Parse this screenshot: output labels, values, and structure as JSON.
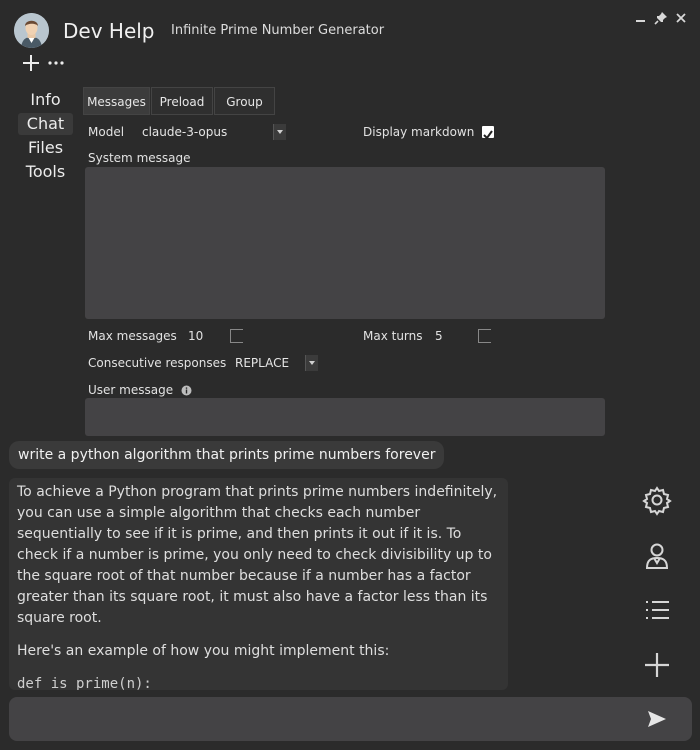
{
  "header": {
    "app_title": "Dev Help",
    "chat_title": "Infinite Prime Number Generator",
    "minimize_icon": "minimize-icon",
    "pin_icon": "pin-icon",
    "close_icon": "close-icon"
  },
  "toolbar": {
    "add_label": "+",
    "more_label": "···"
  },
  "nav": {
    "items": [
      {
        "label": "Info",
        "active": false
      },
      {
        "label": "Chat",
        "active": true
      },
      {
        "label": "Files",
        "active": false
      },
      {
        "label": "Tools",
        "active": false
      }
    ]
  },
  "tabs": [
    {
      "label": "Messages",
      "active": true
    },
    {
      "label": "Preload",
      "active": false
    },
    {
      "label": "Group",
      "active": false
    }
  ],
  "settings": {
    "model_label": "Model",
    "model_value": "claude-3-opus",
    "display_markdown_label": "Display markdown",
    "display_markdown_checked": true,
    "system_message_label": "System message",
    "system_message_value": "",
    "max_messages_label": "Max messages",
    "max_messages_value": "10",
    "max_turns_label": "Max turns",
    "max_turns_value": "5",
    "consecutive_label": "Consecutive responses",
    "consecutive_value": "REPLACE",
    "user_message_label": "User message",
    "user_message_value": ""
  },
  "chat": {
    "user_message": "write a python algorithm that prints prime numbers forever",
    "assistant_paragraphs": [
      "To achieve a Python program that prints prime numbers indefinitely, you can use a simple algorithm that checks each number sequentially to see if it is prime, and then prints it out if it is. To check if a number is prime, you only need to check divisibility up to the square root of that number because if a number has a factor greater than its square root, it must also have a factor less than its square root.",
      "Here's an example of how you might implement this:"
    ],
    "assistant_code": "def is_prime(n):"
  },
  "side_icons": [
    "gear-icon",
    "user-icon",
    "list-icon",
    "plus-icon"
  ],
  "input": {
    "value": "",
    "send_icon": "send-icon"
  },
  "colors": {
    "background": "#2b2b2b",
    "panel": "#444345",
    "bubble": "#3a3a3a"
  }
}
